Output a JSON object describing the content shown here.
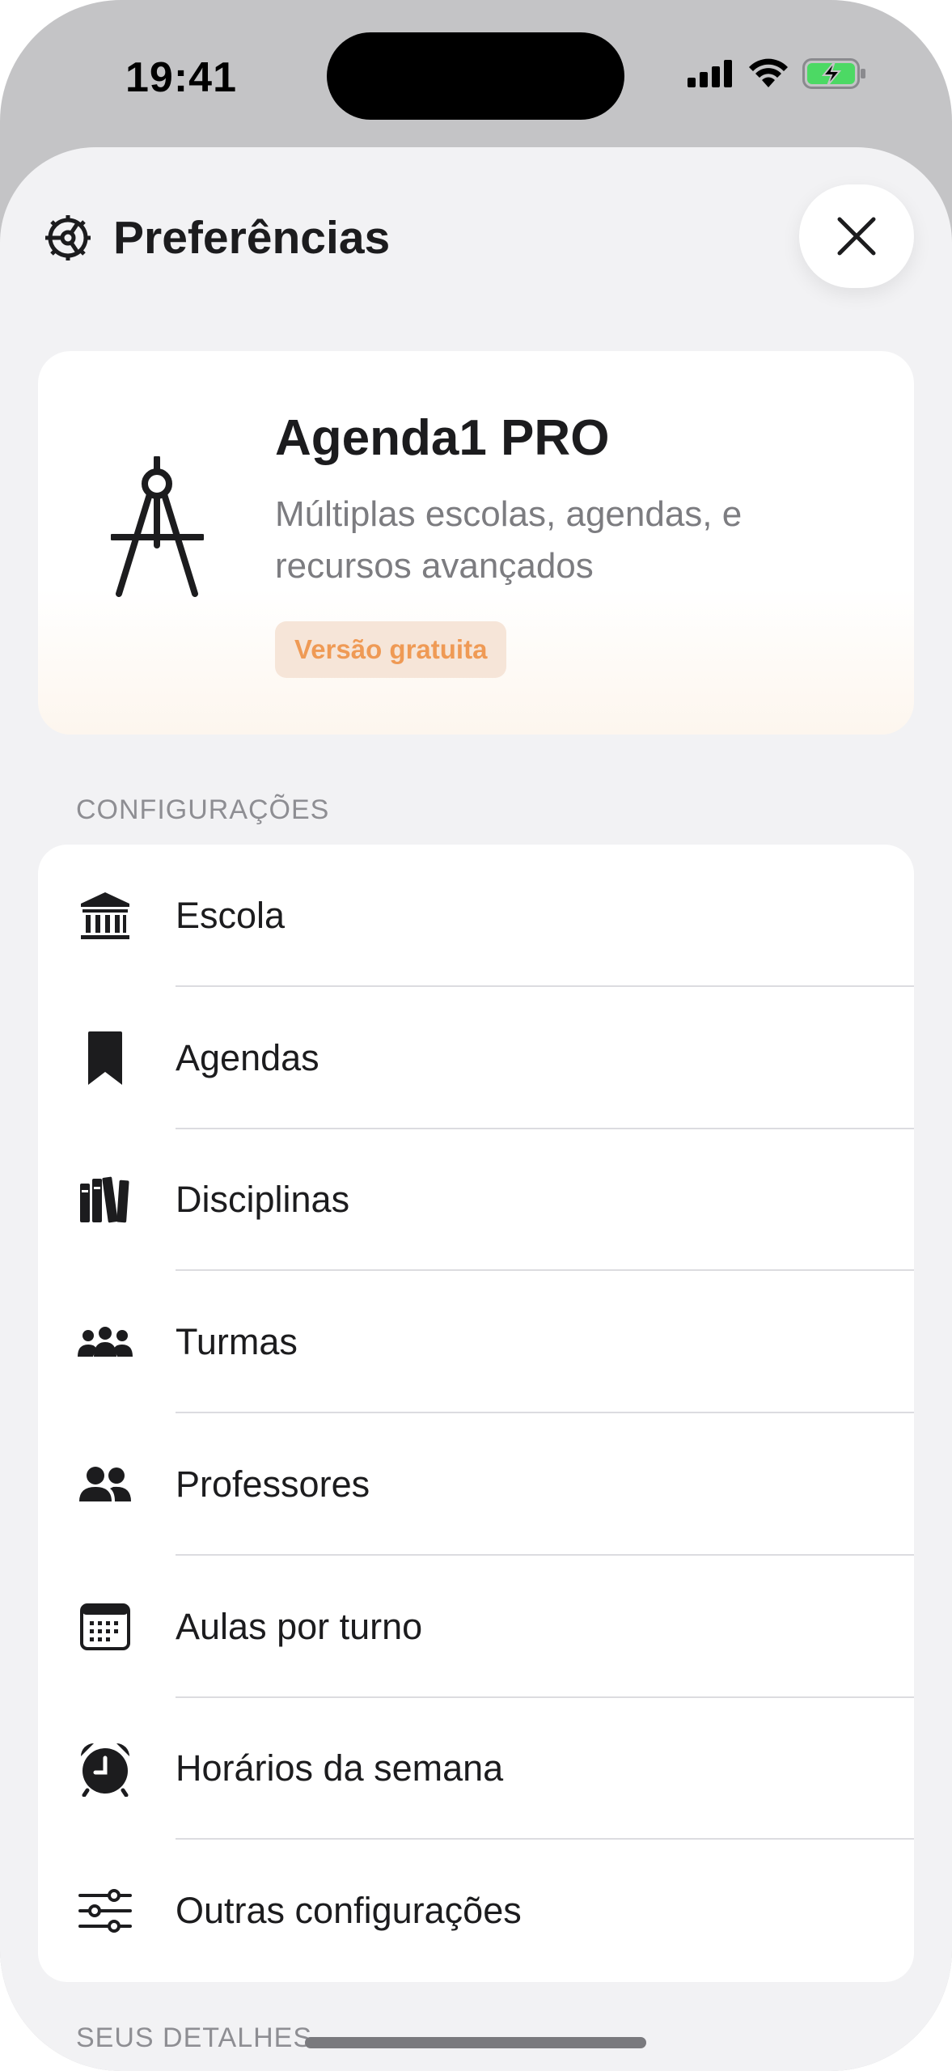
{
  "status_bar": {
    "time": "19:41"
  },
  "header": {
    "title": "Preferências"
  },
  "pro_card": {
    "title": "Agenda1 PRO",
    "subtitle": "Múltiplas escolas, agendas, e recursos avançados",
    "badge": "Versão gratuita"
  },
  "sections": {
    "config_label": "CONFIGURAÇÕES",
    "details_label": "SEUS DETALHES"
  },
  "items": [
    {
      "label": "Escola",
      "icon": "bank-icon"
    },
    {
      "label": "Agendas",
      "icon": "bookmark-icon"
    },
    {
      "label": "Disciplinas",
      "icon": "books-icon"
    },
    {
      "label": "Turmas",
      "icon": "group-icon"
    },
    {
      "label": "Professores",
      "icon": "people-icon"
    },
    {
      "label": "Aulas por turno",
      "icon": "calendar-icon"
    },
    {
      "label": "Horários da semana",
      "icon": "alarm-clock-icon"
    },
    {
      "label": "Outras configurações",
      "icon": "sliders-icon"
    }
  ],
  "colors": {
    "accent_badge_text": "#ef9a55",
    "badge_bg": "#f6e5d8",
    "sheet_bg": "#f2f2f4"
  }
}
